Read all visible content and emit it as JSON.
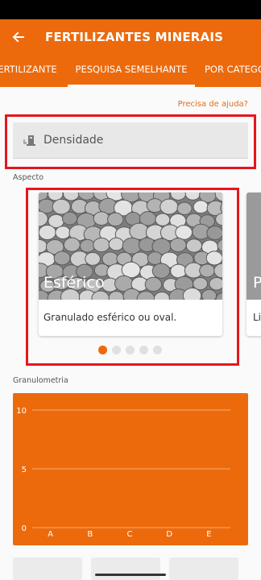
{
  "app": {
    "title": "FERTILIZANTES MINERAIS"
  },
  "tabs": [
    {
      "label": "ERTILIZANTE"
    },
    {
      "label": "PESQUISA SEMELHANTE",
      "active": true
    },
    {
      "label": "POR CATEGO"
    }
  ],
  "help_link": "Precisa de ajuda?",
  "density": {
    "label": "Densidade",
    "icon": "scale-icon"
  },
  "aspecto": {
    "section_label": "Aspecto",
    "cards": [
      {
        "title": "Esférico",
        "description": "Granulado esférico ou oval."
      },
      {
        "title": "P",
        "description": "Li"
      }
    ],
    "dot_count": 5,
    "active_dot": 0
  },
  "granulometria": {
    "section_label": "Granulometria"
  },
  "chart_data": {
    "type": "bar",
    "categories": [
      "A",
      "B",
      "C",
      "D",
      "E"
    ],
    "values": [
      0,
      0,
      0,
      0,
      0
    ],
    "ylim": [
      0,
      10
    ],
    "yticks": [
      0,
      5,
      10
    ],
    "grid": true,
    "background_color": "#ec6a0c",
    "title": "",
    "xlabel": "",
    "ylabel": ""
  },
  "colors": {
    "accent": "#ec6a0c",
    "highlight": "#e5161d"
  }
}
